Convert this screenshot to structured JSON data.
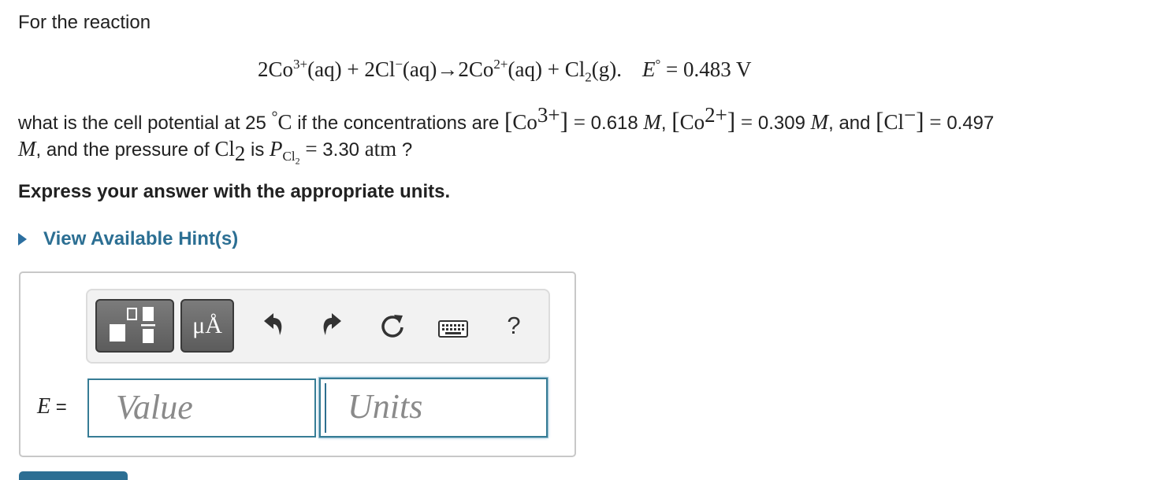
{
  "problem": {
    "intro": "For the reaction",
    "reaction": {
      "coef_co3": "2Co",
      "charge_co3": "3+",
      "state_aq1": "(aq)",
      "plus1": " + ",
      "coef_cl": "2Cl",
      "charge_cl": "−",
      "state_aq2": "(aq)",
      "arrow": "→",
      "coef_co2": "2Co",
      "charge_co2": "2+",
      "state_aq3": "(aq)",
      "plus2": " + ",
      "cl2_base": "Cl",
      "cl2_sub": "2",
      "state_g": "(g).",
      "e_symbol": "E",
      "degree": "°",
      "equals": " = ",
      "e_value": "0.483 V"
    },
    "question_line1": {
      "part1": "what is the cell potential at 25 ",
      "degree": "°",
      "unit_c": "C",
      "part2": " if the concentrations are ",
      "co3_label": "Co",
      "co3_charge": "3+",
      "eq1": " = ",
      "co3_value": "0.618 ",
      "M1": "M",
      "sep1": ", ",
      "co2_label": "Co",
      "co2_charge": "2+",
      "eq2": " = ",
      "co2_value": "0.309 ",
      "M2": "M",
      "sep2": ", and ",
      "cl_label": "Cl",
      "cl_charge": "−",
      "eq3": " = ",
      "cl_value": "0.497"
    },
    "question_line2": {
      "M3": "M",
      "part1": ", and the pressure of ",
      "cl2_base": "Cl",
      "cl2_sub": "2",
      "part2": " is ",
      "p_symbol": "P",
      "p_sub_base": "Cl",
      "p_sub_sub": "2",
      "eq": " = ",
      "p_value": "3.30 ",
      "p_unit": "atm",
      "end": " ?"
    },
    "instruction": "Express your answer with the appropriate units."
  },
  "hint": {
    "label": "View Available Hint(s)"
  },
  "toolbar": {
    "units_button_label": "μÅ",
    "help_label": "?"
  },
  "answer": {
    "variable": "E",
    "equals": " =",
    "value_placeholder": "Value",
    "units_placeholder": "Units"
  },
  "colors": {
    "link": "#2c6f93",
    "field_border": "#367c95",
    "submit": "#2c6e93"
  },
  "icons": [
    "templates-icon",
    "units-icon",
    "undo-icon",
    "redo-icon",
    "reset-icon",
    "keyboard-icon",
    "help-icon"
  ]
}
